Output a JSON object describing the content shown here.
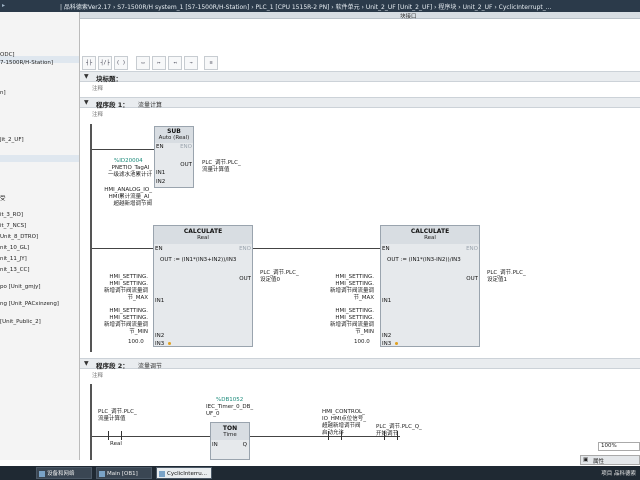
{
  "titlebar": {
    "text": "| 品科德索Ver2.17 › S7-1500R/H system_1 [S7-1500R/H-Station] › PLC_1 [CPU 1515R-2 PN] › 软件单元 › Unit_2_UF [Unit_2_UF] › 程序块 › Unit_2_UF › CyclicInterrupt_..."
  },
  "left_panel": {
    "items": [
      "ODC]",
      "7-1500R/H-Station]",
      "n]",
      "Jit_2_UF]",
      "受",
      "it_3_RO]",
      "it_7_NCS]",
      "Unit_8_DTRO]",
      "nit_10_GL]",
      "nit_11_JY]",
      "nit_13_CC]",
      "po [Unit_gmjy]",
      "ng [Unit_PACxinzeng]",
      "[Unit_Public_2]"
    ]
  },
  "tab_header": {
    "label": "块接口"
  },
  "block_title": {
    "label": "块标题：",
    "comment": "注释"
  },
  "network1": {
    "label": "程序段 1：",
    "title": "流量计算",
    "comment": "注释",
    "sub": {
      "title": "SUB",
      "type": "Auto (Real)",
      "en": "EN",
      "eno": "ENO",
      "in1": "IN1",
      "in2": "IN2",
      "out": "OUT",
      "in1_addr": "%ID20004",
      "in1_sig": "_PNETIO_TagAI_\n一级滤水池累计计",
      "in2_sig": "HMI_ANALOG_IO_\nHMI累计流量_AI_\n超越新增调节阀",
      "out_sig": "PLC_调节.PLC_\n流量计算值"
    },
    "calc1": {
      "title": "CALCULATE",
      "type": "Real",
      "en": "EN",
      "eno": "ENO",
      "formula": "OUT := (IN1*(IN3+IN2))/IN3",
      "in1": "IN1",
      "in2": "IN2",
      "in3": "IN3",
      "out": "OUT",
      "in1_sig": "HMI_SETTING.\nHMI_SETTING.\n新增调节阀流量调\n节_MAX",
      "in2_sig": "HMI_SETTING.\nHMI_SETTING.\n新增调节阀流量调\n节_MIN",
      "in3_val": "100.0",
      "out_sig": "PLC_调节.PLC_\n设定值0"
    },
    "calc2": {
      "title": "CALCULATE",
      "type": "Real",
      "en": "EN",
      "eno": "ENO",
      "formula": "OUT := (IN1*(IN3-IN2))/IN3",
      "in1": "IN1",
      "in2": "IN2",
      "in3": "IN3",
      "out": "OUT",
      "in1_sig": "HMI_SETTING.\nHMI_SETTING.\n新增调节阀流量调\n节_MAX",
      "in2_sig": "HMI_SETTING.\nHMI_SETTING.\n新增调节阀流量调\n节_MIN",
      "in3_val": "100.0",
      "out_sig": "PLC_调节.PLC_\n设定值1"
    }
  },
  "network2": {
    "label": "程序段 2：",
    "title": "流量调节",
    "comment": "注释",
    "contact_sig": "PLC_调节.PLC_\n流量计算值",
    "contact_type": "Real",
    "ton": {
      "db": "%DB1052",
      "instance": "IEC_Timer_0_DB_\nUF_0",
      "title": "TON",
      "type": "Time",
      "in": "IN",
      "q": "Q",
      "pt": "PT",
      "et": "ET"
    },
    "coil1_sig": "HMI_CONTROL_\nIO_HMI点位信号_\n超越新增调节阀\n启动允许",
    "coil2_sig": "PLC_调节.PLC_Q_\n开始调节"
  },
  "zoom": {
    "value": "100%"
  },
  "properties": {
    "label": "属性"
  },
  "taskbar": {
    "items": [
      "设备和网络",
      "Main [OB1]",
      "CyclicInterru..."
    ],
    "right_label": "项目 品科德索"
  }
}
